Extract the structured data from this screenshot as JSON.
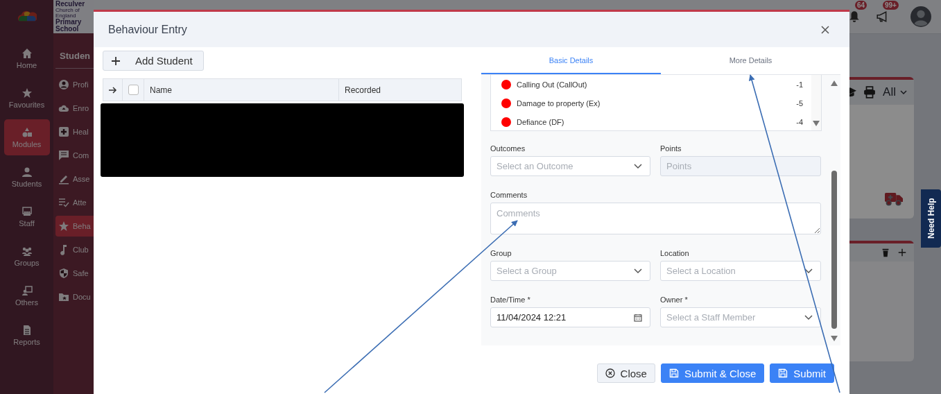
{
  "app": {
    "logo_lines": [
      "Reculver",
      "Church of England",
      "Primary",
      "School"
    ],
    "rail": [
      {
        "label": "Home",
        "selected": false
      },
      {
        "label": "Favourites",
        "selected": false
      },
      {
        "label": "Modules",
        "selected": true
      },
      {
        "label": "Students",
        "selected": false
      },
      {
        "label": "Staff",
        "selected": false
      },
      {
        "label": "Groups",
        "selected": false
      },
      {
        "label": "Others",
        "selected": false
      },
      {
        "label": "Reports",
        "selected": false
      }
    ],
    "section_title": "Studen",
    "menu": [
      {
        "label": "Profi",
        "selected": false
      },
      {
        "label": "Enro",
        "selected": false
      },
      {
        "label": "Heal",
        "selected": false
      },
      {
        "label": "Com",
        "selected": false
      },
      {
        "label": "Asse",
        "selected": false
      },
      {
        "label": "Atte",
        "selected": false
      },
      {
        "label": "Beha",
        "selected": true
      },
      {
        "label": "Club",
        "selected": false
      },
      {
        "label": "Safe",
        "selected": false
      },
      {
        "label": "Docu",
        "selected": false
      }
    ],
    "badges": [
      "64",
      "99+"
    ],
    "filter": "All",
    "help_tab": "Need Help"
  },
  "modal": {
    "title": "Behaviour Entry",
    "add_button": "Add Student",
    "table": {
      "select_all_checked": false,
      "columns": [
        "Name",
        "Recorded"
      ]
    },
    "tabs": [
      {
        "label": "Basic Details",
        "selected": true
      },
      {
        "label": "More Details",
        "selected": false
      }
    ],
    "behaviours": [
      {
        "name": "Calling Out (CallOut)",
        "points": "-1",
        "color": "#ff0000"
      },
      {
        "name": "Damage to property (Ex)",
        "points": "-5",
        "color": "#ff0000"
      },
      {
        "name": "Defiance (DF)",
        "points": "-4",
        "color": "#ff0000"
      }
    ],
    "fields": [
      {
        "kind": "select",
        "label": "Outcomes",
        "placeholder": "Select an Outcome",
        "disabled": false
      },
      {
        "kind": "text",
        "label": "Points",
        "placeholder": "Points",
        "disabled": true
      },
      {
        "kind": "textarea",
        "label": "Comments",
        "placeholder": "Comments",
        "disabled": false
      },
      {
        "kind": "select",
        "label": "Group",
        "placeholder": "Select a Group",
        "disabled": false
      },
      {
        "kind": "select",
        "label": "Location",
        "placeholder": "Select a Location",
        "disabled": false
      },
      {
        "kind": "date",
        "label": "Date/Time *",
        "value": "11/04/2024 12:21",
        "disabled": false
      },
      {
        "kind": "select",
        "label": "Owner *",
        "placeholder": "Select a Staff Member",
        "disabled": false
      }
    ],
    "buttons": [
      {
        "label": "Close",
        "kind": "secondary"
      },
      {
        "label": "Submit & Close",
        "kind": "primary"
      },
      {
        "label": "Submit",
        "kind": "primary"
      }
    ]
  }
}
